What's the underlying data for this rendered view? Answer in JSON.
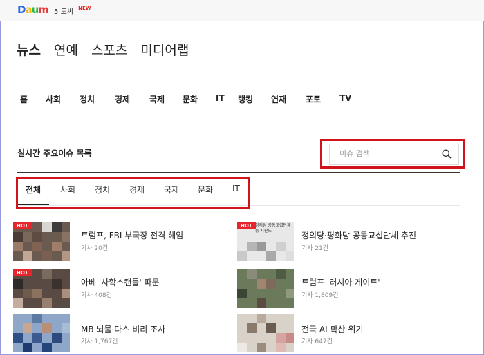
{
  "logo": {
    "d": "D",
    "a": "a",
    "u": "u",
    "m": "m"
  },
  "weather": {
    "temp": "5",
    "unit": "도씨",
    "badge": "NEW"
  },
  "sections": [
    {
      "label": "뉴스",
      "active": true
    },
    {
      "label": "연예"
    },
    {
      "label": "스포츠"
    },
    {
      "label": "미디어랩"
    }
  ],
  "nav": [
    "홈",
    "사회",
    "정치",
    "경제",
    "국제",
    "문화",
    "IT",
    "랭킹",
    "연재",
    "포토",
    "TV"
  ],
  "issue_list": {
    "title": "실시간 주요이슈 목록",
    "search_placeholder": "이슈 검색"
  },
  "tabs": [
    "전체",
    "사회",
    "정치",
    "경제",
    "국제",
    "문화",
    "IT"
  ],
  "issues": [
    {
      "hot": "HOT",
      "title": "트럼프, FBI 부국장 전격 해임",
      "count": "기사 20건"
    },
    {
      "hot": "HOT",
      "title": "정의당·평화당 공동교섭단체 추진",
      "count": "기사 21건",
      "thumb_text": "정의당 공동교섭단체\n등 지원도"
    },
    {
      "hot": "HOT",
      "title": "아베 '사학스캔들' 파문",
      "count": "기사 408건"
    },
    {
      "title": "트럼프 '러시아 게이트'",
      "count": "기사 1,809건"
    },
    {
      "title": "MB 뇌물·다스 비리 조사",
      "count": "기사 1,767건"
    },
    {
      "title": "전국 AI 확산 위기",
      "count": "기사 647건"
    }
  ],
  "colors": {
    "accent": "#d0141a",
    "hot": "#e6262c"
  }
}
